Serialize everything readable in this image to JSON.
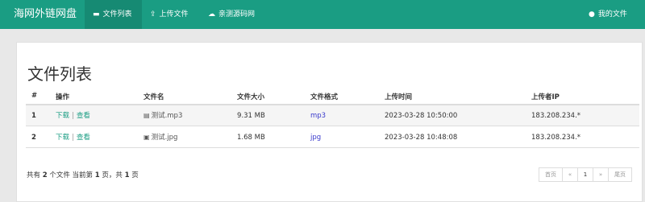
{
  "nav": {
    "brand": "海网外链网盘",
    "items": [
      {
        "label": "文件列表",
        "icon": "folder-open-icon"
      },
      {
        "label": "上传文件",
        "icon": "upload-icon"
      },
      {
        "label": "亲测源码网",
        "icon": "cloud-icon"
      }
    ],
    "right": {
      "label": "我的文件",
      "icon": "user-icon"
    }
  },
  "main": {
    "title": "文件列表",
    "columns": [
      "#",
      "操作",
      "文件名",
      "文件大小",
      "文件格式",
      "上传时间",
      "上传者IP"
    ],
    "rows": [
      {
        "no": "1",
        "download": "下载",
        "view": "查看",
        "name": "测试.mp3",
        "file_icon": "audio-file-icon",
        "size": "9.31 MB",
        "format": "mp3",
        "time": "2023-03-28 10:50:00",
        "ip": "183.208.234.*"
      },
      {
        "no": "2",
        "download": "下载",
        "view": "查看",
        "name": "测试.jpg",
        "file_icon": "image-file-icon",
        "size": "1.68 MB",
        "format": "jpg",
        "time": "2023-03-28 10:48:08",
        "ip": "183.208.234.*"
      }
    ],
    "op_separator": "|"
  },
  "footer": {
    "prefix": "共有",
    "total": "2",
    "mid": "个文件  当前第",
    "page": "1",
    "mid2": "页，共",
    "pages": "1",
    "suffix": "页"
  },
  "pagination": {
    "first": "首页",
    "prev": "«",
    "current": "1",
    "next": "»",
    "last": "尾页"
  },
  "colors": {
    "navbar": "#1a9d83",
    "link": "#1a9d83",
    "format": "#3a3acc"
  }
}
